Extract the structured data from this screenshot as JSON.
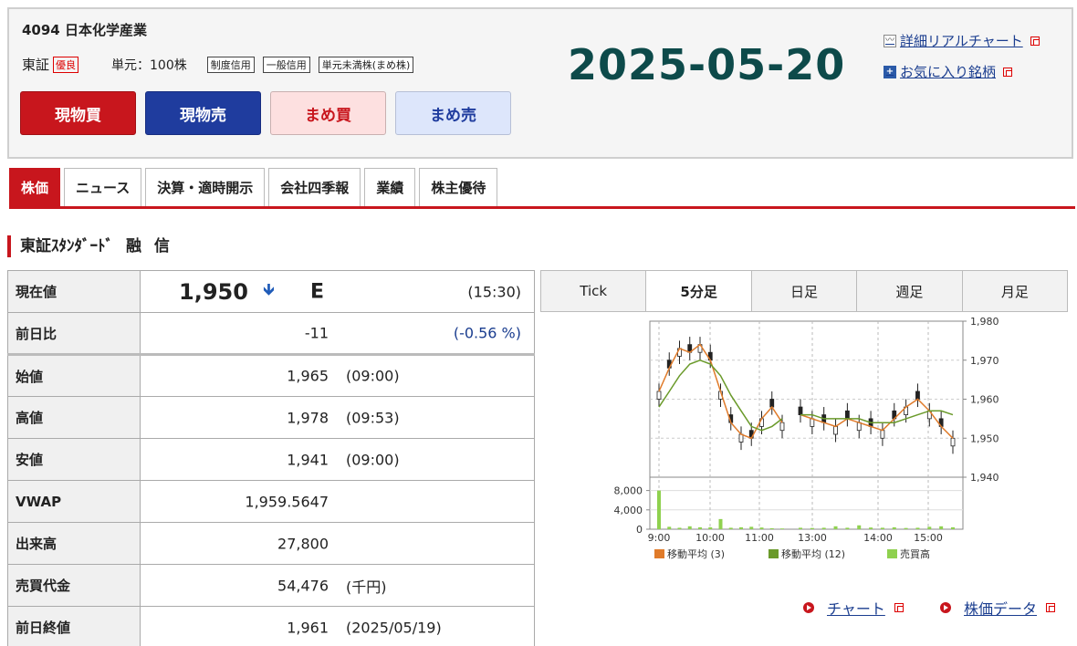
{
  "header": {
    "code_name": "4094 日本化学産業",
    "market": "東証",
    "market_badge": "優良",
    "unit": "単元：100株",
    "tags": [
      "制度信用",
      "一般信用",
      "単元未満株(まめ株)"
    ],
    "date": "2025-05-20",
    "link_chart": "詳細リアルチャート",
    "link_fav": "お気に入り銘柄"
  },
  "trade_buttons": {
    "buy": "現物買",
    "sell": "現物売",
    "mame_buy": "まめ買",
    "mame_sell": "まめ売"
  },
  "tabs": [
    "株価",
    "ニュース",
    "決算・適時開示",
    "会社四季報",
    "業績",
    "株主優待"
  ],
  "section": {
    "market_name": "東証ｽﾀﾝﾀﾞｰﾄﾞ",
    "margin": "融 信"
  },
  "quote": {
    "current_label": "現在値",
    "current_price": "1,950",
    "current_flag": "E",
    "current_time": "(15:30)",
    "change_label": "前日比",
    "change": "-11",
    "change_pct": "(-0.56 %)",
    "rows": [
      {
        "label": "始値",
        "value": "1,965",
        "sub": "(09:00)"
      },
      {
        "label": "高値",
        "value": "1,978",
        "sub": "(09:53)"
      },
      {
        "label": "安値",
        "value": "1,941",
        "sub": "(09:00)"
      },
      {
        "label": "VWAP",
        "value": "1,959.5647",
        "sub": ""
      },
      {
        "label": "出来高",
        "value": "27,800",
        "sub": ""
      },
      {
        "label": "売買代金",
        "value": "54,476",
        "sub": "(千円)"
      },
      {
        "label": "前日終値",
        "value": "1,961",
        "sub": "(2025/05/19)"
      }
    ]
  },
  "period_tabs": [
    "Tick",
    "5分足",
    "日足",
    "週足",
    "月足"
  ],
  "chart_data": {
    "type": "line",
    "price_ticks": [
      "1,980",
      "1,970",
      "1,960",
      "1,950",
      "1,940"
    ],
    "volume_ticks": [
      "8,000",
      "4,000",
      "0"
    ],
    "x_ticks": [
      "9:00",
      "10:00",
      "11:00",
      "13:00",
      "14:00",
      "15:00"
    ],
    "ylim": [
      1940,
      1980
    ],
    "legend": [
      "移動平均 (3)",
      "移動平均 (12)",
      "売買高"
    ],
    "series": [
      {
        "name": "移動平均 (3)",
        "values": [
          1962,
          1968,
          1973,
          1972,
          1974,
          1970,
          1962,
          1954,
          1951,
          1950,
          1955,
          1958,
          1954,
          1956,
          1955,
          1954,
          1953,
          1955,
          1954,
          1953,
          1952,
          1955,
          1958,
          1960,
          1957,
          1953,
          1950
        ]
      },
      {
        "name": "移動平均 (12)",
        "values": [
          1958,
          1962,
          1966,
          1969,
          1970,
          1969,
          1966,
          1961,
          1957,
          1953,
          1952,
          1953,
          1955,
          1956,
          1956,
          1955,
          1955,
          1955,
          1955,
          1954,
          1954,
          1954,
          1955,
          1956,
          1957,
          1957,
          1956
        ]
      }
    ],
    "volume": [
      8000,
      500,
      300,
      600,
      400,
      400,
      2100,
      300,
      400,
      500,
      350,
      200,
      150,
      300,
      250,
      300,
      600,
      300,
      800,
      350,
      300,
      400,
      250,
      300,
      500,
      600,
      400
    ],
    "colors": {
      "ma3": "#e07b2a",
      "ma12": "#6a9a2a",
      "volume": "#8fd14f"
    }
  },
  "chart_links": {
    "chart": "チャート",
    "price_data": "株価データ"
  }
}
